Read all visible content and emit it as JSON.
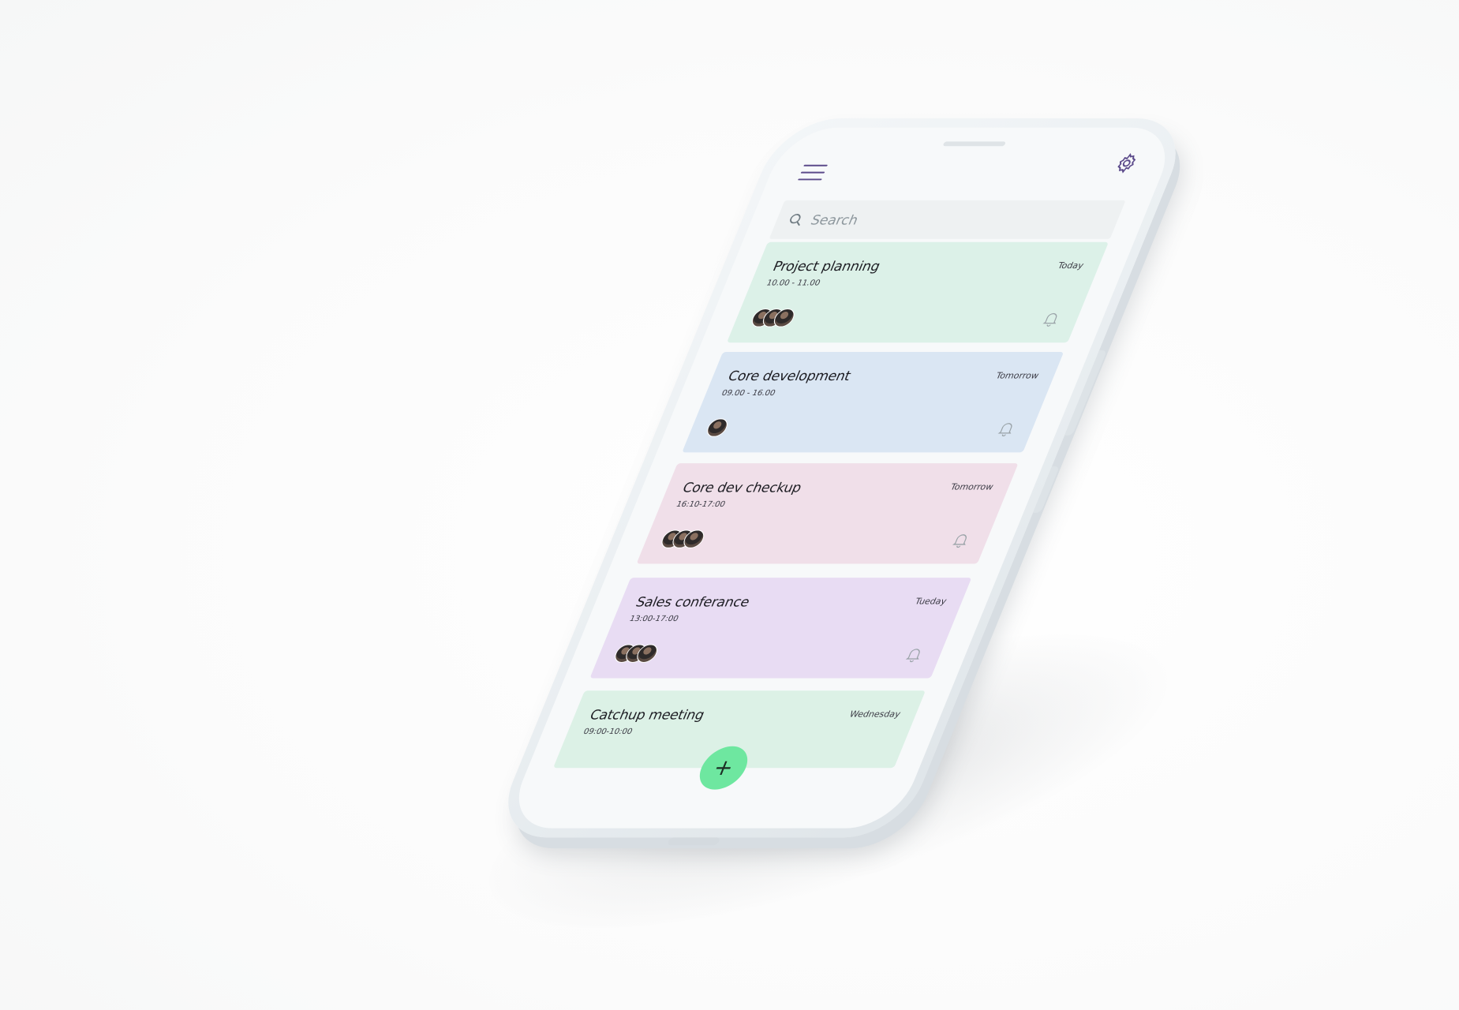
{
  "search": {
    "placeholder": "Search",
    "icon": "search-icon"
  },
  "header": {
    "menu_icon": "menu-icon",
    "settings_icon": "gear-icon"
  },
  "events": [
    {
      "title": "Project planning",
      "time": "10.00 - 11.00",
      "day": "Today",
      "color": "#dcf1e8",
      "attendees": 3
    },
    {
      "title": "Core development",
      "time": "09.00 - 16.00",
      "day": "Tomorrow",
      "color": "#dae6f3",
      "attendees": 1
    },
    {
      "title": "Core dev checkup",
      "time": "16:10-17:00",
      "day": "Tomorrow",
      "color": "#f0dfe9",
      "attendees": 3
    },
    {
      "title": "Sales conferance",
      "time": "13:00-17:00",
      "day": "Tueday",
      "color": "#e8dcf3",
      "attendees": 3
    },
    {
      "title": "Catchup meeting",
      "time": "09:00-10:00",
      "day": "Wednesday",
      "color": "#dcf1e6",
      "attendees": 0
    }
  ],
  "fab": {
    "label": "+",
    "color": "#6ee7a0"
  }
}
